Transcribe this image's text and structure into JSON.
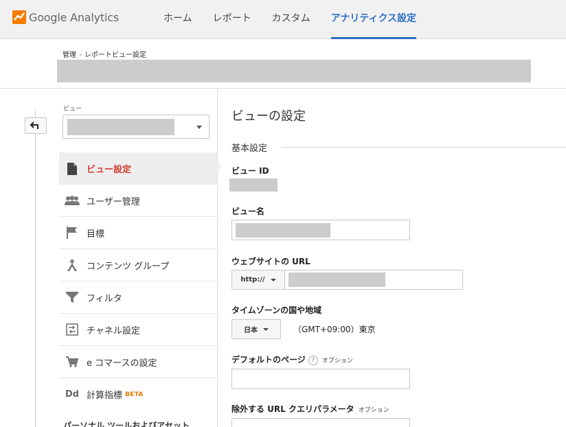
{
  "app": {
    "brand": "Google Analytics",
    "brand_colors": {
      "logo_orange": "#f57c00",
      "logo_dark": "#e65100"
    }
  },
  "nav": {
    "items": [
      {
        "label": "ホーム"
      },
      {
        "label": "レポート"
      },
      {
        "label": "カスタム"
      },
      {
        "label": "アナリティクス設定",
        "active": true
      }
    ]
  },
  "breadcrumb": {
    "root": "管理",
    "separator": "›",
    "current": "レポートビュー設定"
  },
  "view_selector": {
    "label": "ビュー"
  },
  "sidebar": {
    "items": [
      {
        "label": "ビュー設定",
        "icon": "document-icon",
        "active": true
      },
      {
        "label": "ユーザー管理",
        "icon": "people-icon"
      },
      {
        "label": "目標",
        "icon": "flag-icon"
      },
      {
        "label": "コンテンツ グループ",
        "icon": "content-group-icon"
      },
      {
        "label": "フィルタ",
        "icon": "filter-icon"
      },
      {
        "label": "チャネル設定",
        "icon": "channel-icon"
      },
      {
        "label": "e コマースの設定",
        "icon": "cart-icon"
      },
      {
        "label": "計算指標",
        "icon": "dd-icon",
        "badge": "BETA"
      }
    ],
    "cut_off_label": "パーソナル ツールおよびアセット"
  },
  "panel": {
    "title": "ビューの設定",
    "section": "基本設定",
    "fields": {
      "view_id_label": "ビュー ID",
      "view_name_label": "ビュー名",
      "website_url_label": "ウェブサイトの URL",
      "protocol": "http://",
      "timezone_label": "タイムゾーンの国や地域",
      "country": "日本",
      "timezone": "（GMT+09:00）東京",
      "default_page_label": "デフォルトのページ",
      "default_page_help": "?",
      "default_page_optional": "オプション",
      "exclude_params_label": "除外する URL クエリパラメータ",
      "exclude_params_optional": "オプション"
    }
  },
  "colors": {
    "accent": "#2d6fc5",
    "active_menu": "#d23f31",
    "beta": "#e37400",
    "redaction": "#cccccc"
  }
}
